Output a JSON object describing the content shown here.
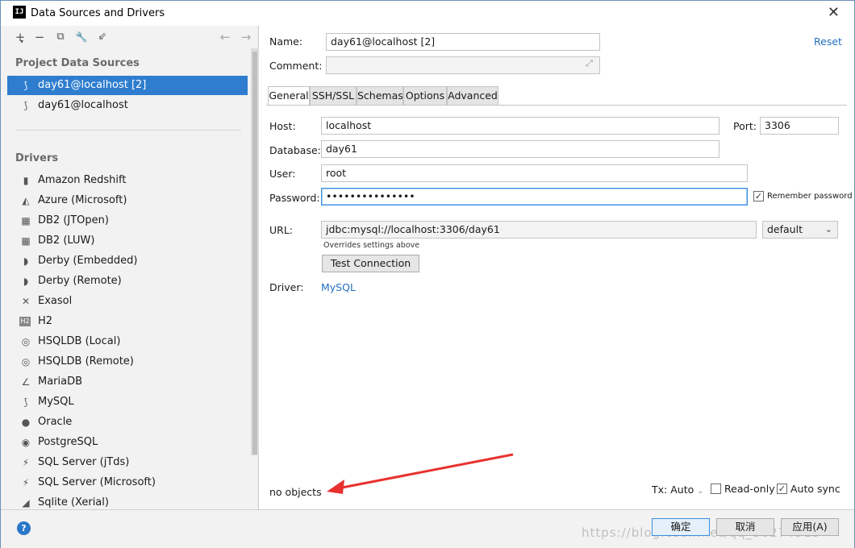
{
  "window": {
    "title": "Data Sources and Drivers",
    "app_icon_text": "IJ",
    "close_glyph": "✕"
  },
  "left_toolbar": {
    "add": "+",
    "add_caret": "▾",
    "remove": "−",
    "copy": "⧉",
    "properties": "🔧",
    "import": "⇙",
    "back": "←",
    "forward": "→"
  },
  "project_data_sources": {
    "heading": "Project Data Sources",
    "items": [
      {
        "label": "day61@localhost [2]",
        "icon": "mysql-dolphin-icon",
        "selected": true
      },
      {
        "label": "day61@localhost",
        "icon": "mysql-dolphin-icon",
        "selected": false
      }
    ]
  },
  "drivers": {
    "heading": "Drivers",
    "items": [
      {
        "label": "Amazon Redshift",
        "icon": "redshift-icon",
        "glyph": "▮"
      },
      {
        "label": "Azure (Microsoft)",
        "icon": "azure-icon",
        "glyph": "◭"
      },
      {
        "label": "DB2 (JTOpen)",
        "icon": "db2-icon",
        "glyph": "▦"
      },
      {
        "label": "DB2 (LUW)",
        "icon": "db2-icon",
        "glyph": "▦"
      },
      {
        "label": "Derby (Embedded)",
        "icon": "derby-hat-icon",
        "glyph": "◗"
      },
      {
        "label": "Derby (Remote)",
        "icon": "derby-hat-icon",
        "glyph": "◗"
      },
      {
        "label": "Exasol",
        "icon": "exasol-icon",
        "glyph": "✕"
      },
      {
        "label": "H2",
        "icon": "h2-icon",
        "glyph": "H2"
      },
      {
        "label": "HSQLDB (Local)",
        "icon": "hsqldb-icon",
        "glyph": "◎"
      },
      {
        "label": "HSQLDB (Remote)",
        "icon": "hsqldb-icon",
        "glyph": "◎"
      },
      {
        "label": "MariaDB",
        "icon": "mariadb-seal-icon",
        "glyph": "∠"
      },
      {
        "label": "MySQL",
        "icon": "mysql-dolphin-icon",
        "glyph": "⟆"
      },
      {
        "label": "Oracle",
        "icon": "oracle-icon",
        "glyph": "●"
      },
      {
        "label": "PostgreSQL",
        "icon": "postgresql-elephant-icon",
        "glyph": "◉"
      },
      {
        "label": "SQL Server (jTds)",
        "icon": "sqlserver-icon",
        "glyph": "⚡"
      },
      {
        "label": "SQL Server (Microsoft)",
        "icon": "sqlserver-icon",
        "glyph": "⚡"
      },
      {
        "label": "Sqlite (Xerial)",
        "icon": "sqlite-feather-icon",
        "glyph": "◢"
      }
    ]
  },
  "form": {
    "name_label": "Name:",
    "name_value": "day61@localhost [2]",
    "comment_label": "Comment:",
    "comment_value": "",
    "reset_label": "Reset",
    "tabs": [
      {
        "label": "General",
        "active": true
      },
      {
        "label": "SSH/SSL",
        "active": false
      },
      {
        "label": "Schemas",
        "active": false
      },
      {
        "label": "Options",
        "active": false
      },
      {
        "label": "Advanced",
        "active": false
      }
    ],
    "host_label": "Host:",
    "host_value": "localhost",
    "port_label": "Port:",
    "port_value": "3306",
    "database_label": "Database:",
    "database_value": "day61",
    "user_label": "User:",
    "user_value": "root",
    "password_label": "Password:",
    "password_value": "•••••••••••••••",
    "remember_password_label": "Remember password",
    "remember_password_checked": true,
    "url_label": "URL:",
    "url_value": "jdbc:mysql://localhost:3306/day61",
    "url_hint": "Overrides settings above",
    "url_mode": "default",
    "test_connection_label": "Test Connection",
    "driver_label": "Driver:",
    "driver_value": "MySQL"
  },
  "status": {
    "objects_text": "no objects",
    "tx_label": "Tx: Auto",
    "read_only_label": "Read-only",
    "read_only_checked": false,
    "auto_sync_label": "Auto sync",
    "auto_sync_checked": true
  },
  "footer": {
    "help": "?",
    "ok_label": "确定",
    "cancel_label": "取消",
    "apply_label": "应用(A)",
    "watermark": "https://blog.csdn.net/qq_36274515"
  },
  "colors": {
    "selection": "#2e7dcf",
    "link": "#2470c2",
    "annotation_arrow": "#e8312f"
  }
}
